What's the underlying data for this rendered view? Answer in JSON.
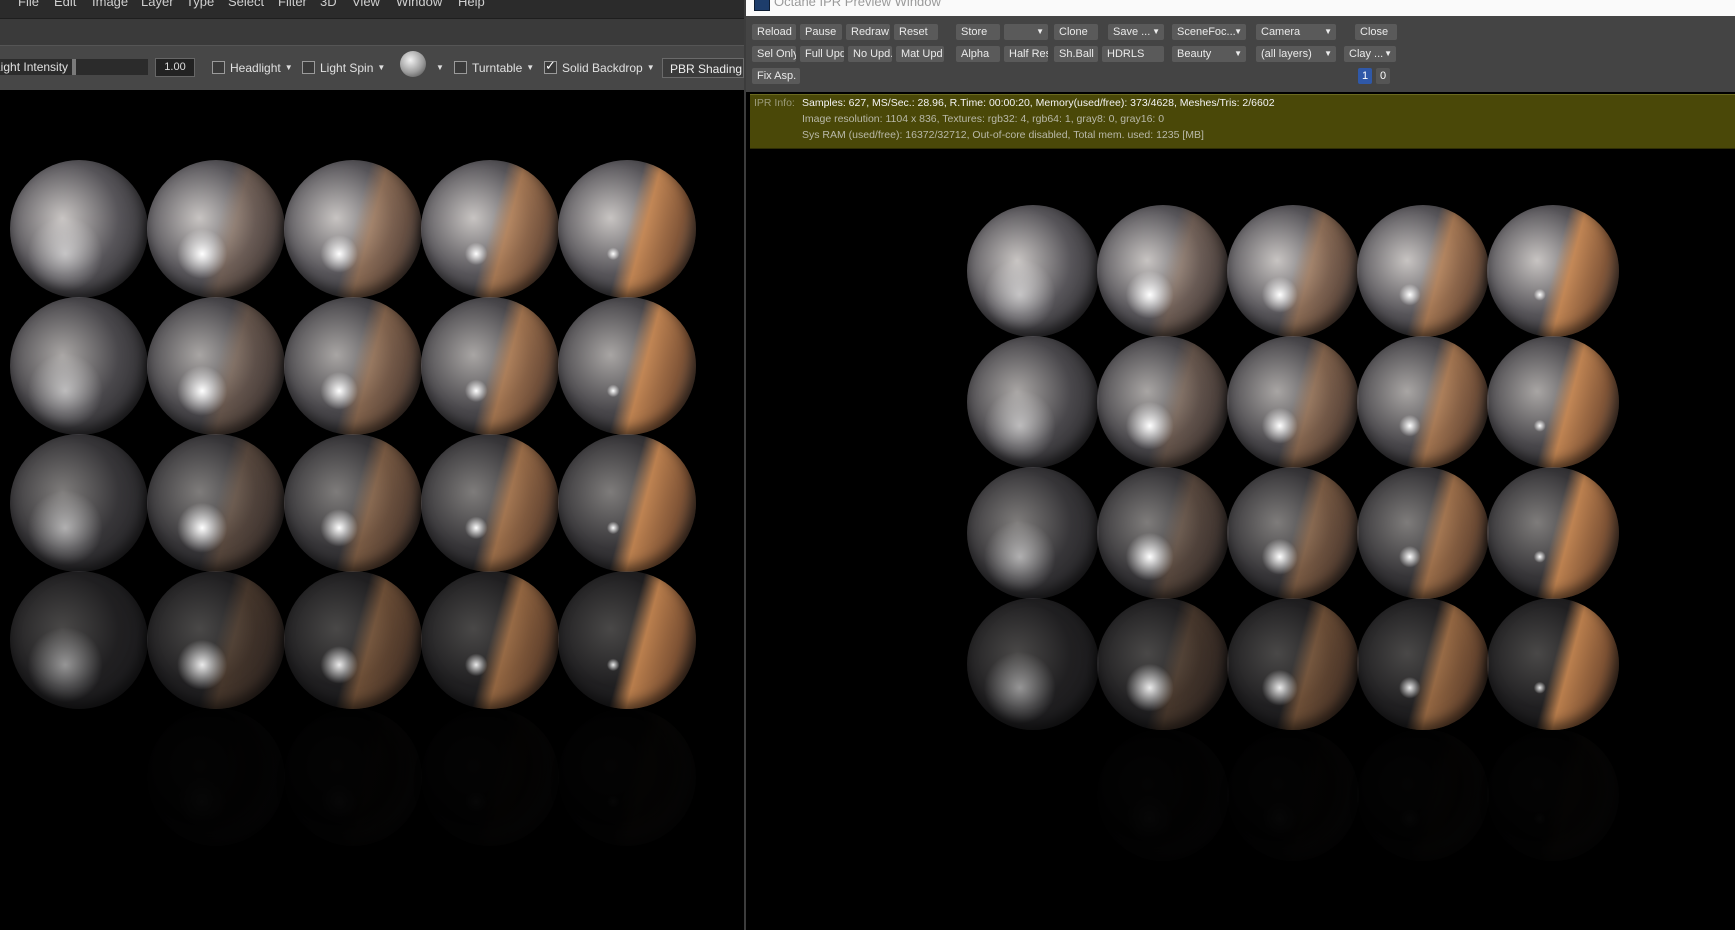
{
  "ps": {
    "menu": [
      "File",
      "Edit",
      "Image",
      "Layer",
      "Type",
      "Select",
      "Filter",
      "3D",
      "View",
      "Window",
      "Help"
    ],
    "options": {
      "light_intensity_label": "Light Intensity",
      "light_intensity_value": "1.00",
      "headlight": "Headlight",
      "light_spin": "Light Spin",
      "turntable": "Turntable",
      "solid_backdrop": "Solid Backdrop",
      "pbr_shading": "PBR Shading"
    }
  },
  "ipr": {
    "title": "Octane IPR Preview Window",
    "buttons": {
      "reload": "Reload",
      "pause": "Pause",
      "redraw": "Redraw",
      "reset": "Reset",
      "store": "Store",
      "clone": "Clone",
      "save": "Save ...",
      "scene_focus": "SceneFoc...",
      "camera": "Camera",
      "close": "Close",
      "sel_only": "Sel Only",
      "full_upd": "Full Upd.",
      "no_upd": "No Upd.",
      "mat_upd": "Mat Upd",
      "alpha": "Alpha",
      "half_res": "Half Res",
      "sh_ball": "Sh.Ball",
      "hdrls": "HDRLS",
      "beauty": "Beauty",
      "all_layers": "(all layers)",
      "clay": "Clay ...",
      "fix_asp": "Fix Asp.",
      "page1": "1",
      "page0": "0"
    },
    "info": {
      "label": "IPR Info:",
      "line1": "Samples: 627, MS/Sec.: 28.96, R.Time: 00:00:20, Memory(used/free): 373/4628, Meshes/Tris: 2/6602",
      "line2": "Image resolution: 1104 x 836, Textures: rgb32: 4, rgb64: 1, gray8: 0, gray16: 0",
      "line3": "Sys RAM (used/free): 16372/32712, Out-of-core disabled, Total mem. used: 1235  [MB]"
    }
  },
  "colors": {
    "ps_options_bg": "#474747",
    "ipr_info_bg": "#4a4808",
    "ipr_active_page": "#2f58a8",
    "sphere_tint": "#cd8a52"
  },
  "icons": [
    "sphere-preview-icon",
    "octane-app-icon",
    "checkbox-checked-icon",
    "dropdown-caret-icon"
  ]
}
